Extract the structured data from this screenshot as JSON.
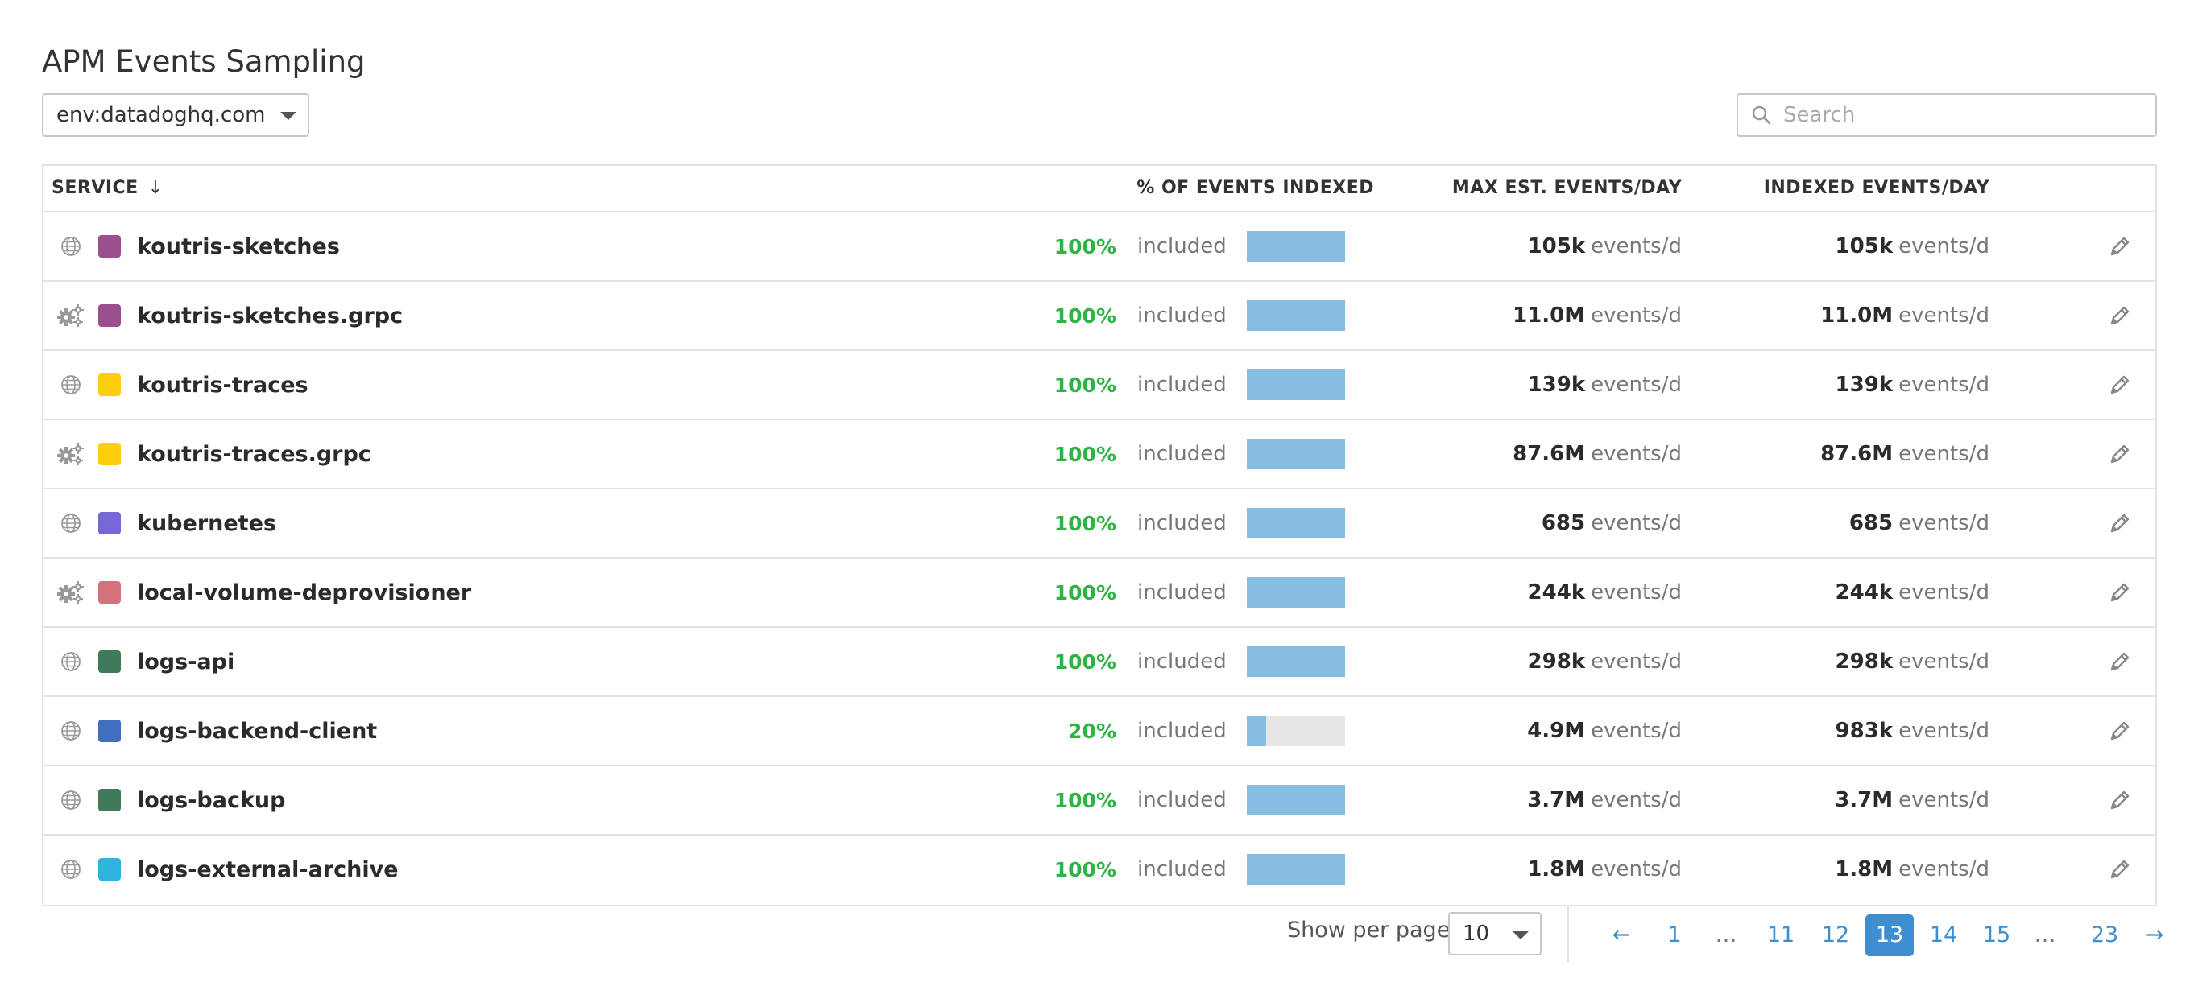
{
  "page": {
    "title": "APM Events Sampling"
  },
  "filter": {
    "env_value": "env:datadoghq.com"
  },
  "search": {
    "placeholder": "Search"
  },
  "table": {
    "headers": {
      "service": "SERVICE",
      "sort_indicator": "↓",
      "pct_indexed": "% OF EVENTS INDEXED",
      "max_est": "MAX EST. EVENTS/DAY",
      "indexed": "INDEXED EVENTS/DAY"
    },
    "unit_label": "events/d",
    "included_label": "included",
    "rows": [
      {
        "type_icon": "globe-icon",
        "color": "#9b4f8e",
        "name": "koutris-sketches",
        "pct": "100%",
        "fill": 1.0,
        "max": "105k",
        "indexed": "105k"
      },
      {
        "type_icon": "gears-icon",
        "color": "#9b4f8e",
        "name": "koutris-sketches.grpc",
        "pct": "100%",
        "fill": 1.0,
        "max": "11.0M",
        "indexed": "11.0M"
      },
      {
        "type_icon": "globe-icon",
        "color": "#ffcf0f",
        "name": "koutris-traces",
        "pct": "100%",
        "fill": 1.0,
        "max": "139k",
        "indexed": "139k"
      },
      {
        "type_icon": "gears-icon",
        "color": "#ffcf0f",
        "name": "koutris-traces.grpc",
        "pct": "100%",
        "fill": 1.0,
        "max": "87.6M",
        "indexed": "87.6M"
      },
      {
        "type_icon": "globe-icon",
        "color": "#7468d4",
        "name": "kubernetes",
        "pct": "100%",
        "fill": 1.0,
        "max": "685",
        "indexed": "685"
      },
      {
        "type_icon": "gears-icon",
        "color": "#d4717c",
        "name": "local-volume-deprovisioner",
        "pct": "100%",
        "fill": 1.0,
        "max": "244k",
        "indexed": "244k"
      },
      {
        "type_icon": "globe-icon",
        "color": "#3f7a5a",
        "name": "logs-api",
        "pct": "100%",
        "fill": 1.0,
        "max": "298k",
        "indexed": "298k"
      },
      {
        "type_icon": "globe-icon",
        "color": "#3f6fbd",
        "name": "logs-backend-client",
        "pct": "20%",
        "fill": 0.2,
        "max": "4.9M",
        "indexed": "983k"
      },
      {
        "type_icon": "globe-icon",
        "color": "#3f7a5a",
        "name": "logs-backup",
        "pct": "100%",
        "fill": 1.0,
        "max": "3.7M",
        "indexed": "3.7M"
      },
      {
        "type_icon": "globe-icon",
        "color": "#31b3e0",
        "name": "logs-external-archive",
        "pct": "100%",
        "fill": 1.0,
        "max": "1.8M",
        "indexed": "1.8M"
      }
    ]
  },
  "pagination": {
    "per_page_label": "Show per page",
    "per_page_value": "10",
    "prev": "←",
    "next": "→",
    "pages": [
      "1",
      "…",
      "11",
      "12",
      "13",
      "14",
      "15",
      "…",
      "23"
    ],
    "active_page": "13"
  }
}
